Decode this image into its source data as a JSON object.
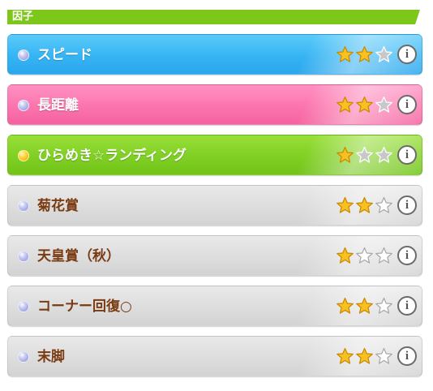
{
  "section": {
    "title": "因子"
  },
  "star_icon": "star-icon",
  "info_icon": "info-icon",
  "info_glyph": "i",
  "colors": {
    "gold": "#f9c021",
    "silver": "#c8c8c8",
    "empty": "#ffffff"
  },
  "factors": [
    {
      "label": "スピード",
      "stars_filled": 2,
      "stars_total": 3,
      "theme": "blue"
    },
    {
      "label": "長距離",
      "stars_filled": 2,
      "stars_total": 3,
      "theme": "pink"
    },
    {
      "label": "ひらめき☆ランディング",
      "stars_filled": 1,
      "stars_total": 3,
      "theme": "green"
    },
    {
      "label": "菊花賞",
      "stars_filled": 2,
      "stars_total": 3,
      "theme": "gray"
    },
    {
      "label": "天皇賞（秋）",
      "stars_filled": 1,
      "stars_total": 3,
      "theme": "gray"
    },
    {
      "label": "コーナー回復○",
      "stars_filled": 2,
      "stars_total": 3,
      "theme": "gray"
    },
    {
      "label": "末脚",
      "stars_filled": 2,
      "stars_total": 3,
      "theme": "gray"
    }
  ]
}
